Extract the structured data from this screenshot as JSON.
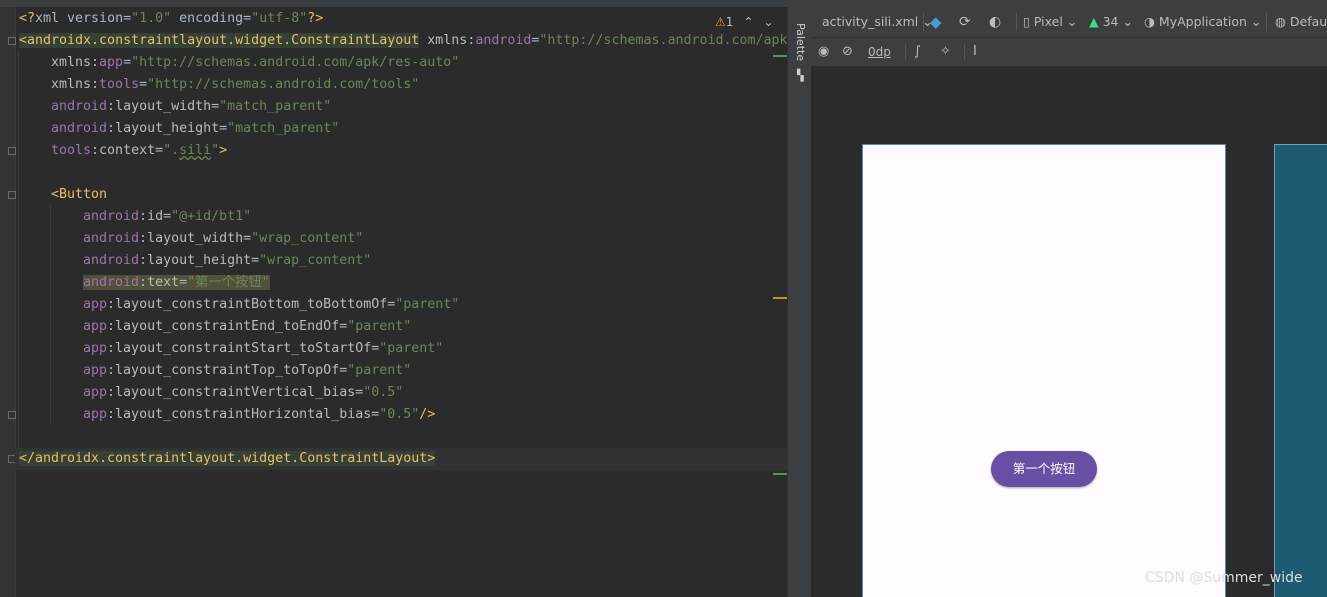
{
  "editor": {
    "lines": {
      "l1": {
        "a": "<?",
        "b": "xml version=",
        "c": "\"1.0\"",
        "d": " encoding=",
        "e": "\"utf-8\"",
        "f": "?>"
      },
      "l2": {
        "a": "<androidx.constraintlayout.widget.ConstraintLayout",
        "b": " xmlns:",
        "c": "android",
        "d": "=",
        "e": "\"http://schemas.android.com/apk"
      },
      "l3": {
        "a": "xmlns:",
        "b": "app",
        "c": "=",
        "d": "\"http://schemas.android.com/apk/res-auto\""
      },
      "l4": {
        "a": "xmlns:",
        "b": "tools",
        "c": "=",
        "d": "\"http://schemas.android.com/tools\""
      },
      "l5": {
        "a": "android",
        ":b": ":",
        "b": "layout_width",
        "c": "=",
        "d": "\"match_parent\""
      },
      "l6": {
        "a": "android",
        "b": "layout_height",
        "c": "=",
        "d": "\"match_parent\""
      },
      "l7": {
        "a": "tools",
        "b": "context",
        "c": "=",
        "d": "\".",
        "e": "sili",
        "f": "\"",
        ">": ">"
      },
      "l8": {
        "a": "<Button"
      },
      "l9": {
        "a": "android",
        "b": "id",
        "c": "=",
        "d": "\"@+id/bt1\""
      },
      "l10": {
        "a": "android",
        "b": "layout_width",
        "c": "=",
        "d": "\"wrap_content\""
      },
      "l11": {
        "a": "android",
        "b": "layout_height",
        "c": "=",
        "d": "\"wrap_content\""
      },
      "l12": {
        "a": "android",
        "b": "text",
        "c": "=",
        "d": "\"第一个按钮\""
      },
      "l13": {
        "a": "app",
        "b": "layout_constraintBottom_toBottomOf",
        "c": "=",
        "d": "\"parent\""
      },
      "l14": {
        "a": "app",
        "b": "layout_constraintEnd_toEndOf",
        "c": "=",
        "d": "\"parent\""
      },
      "l15": {
        "a": "app",
        "b": "layout_constraintStart_toStartOf",
        "c": "=",
        "d": "\"parent\""
      },
      "l16": {
        "a": "app",
        "b": "layout_constraintTop_toTopOf",
        "c": "=",
        "d": "\"parent\""
      },
      "l17": {
        "a": "app",
        "b": "layout_constraintVertical_bias",
        "c": "=",
        "d": "\"0.5\""
      },
      "l18": {
        "a": "app",
        "b": "layout_constraintHorizontal_bias",
        "c": "=",
        "d": "\"0.5\"",
        "e": "/>"
      },
      "l19": {
        "a": "</androidx.constraintlayout.widget.ConstraintLayout>"
      }
    },
    "colon": ":",
    "close_tag": ">",
    "warning_count": "1"
  },
  "palette": {
    "label": "Palette"
  },
  "toolbar": {
    "file_name": "activity_sili.xml",
    "device": "Pixel",
    "api": "34",
    "app": "MyApplication",
    "locale": "Defau",
    "margin": "0dp"
  },
  "preview": {
    "button_text": "第一个按钮"
  },
  "watermark": "CSDN @Summer_wide",
  "colors": {
    "button": "#6750a4",
    "blueprint": "#1e5b73",
    "tag": "#e8bf6a",
    "namespace": "#9876aa",
    "value": "#6a8759"
  }
}
